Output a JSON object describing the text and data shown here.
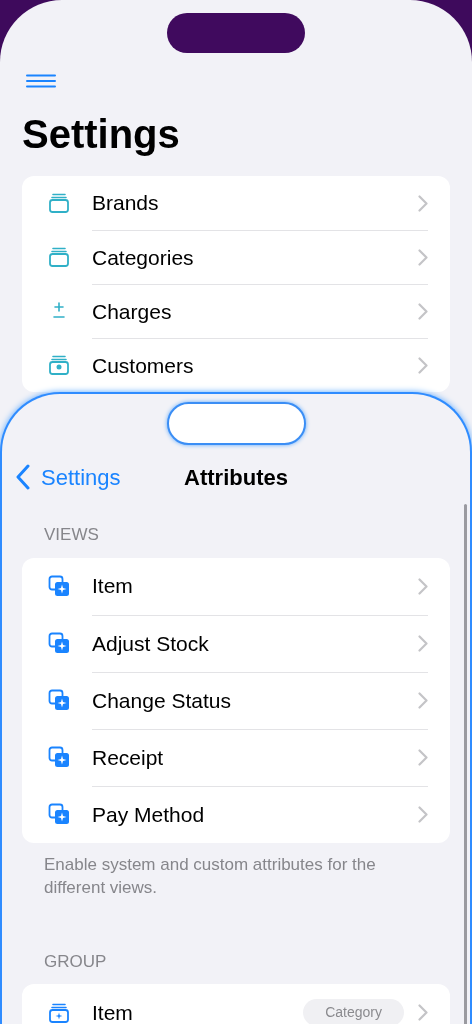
{
  "background_screen": {
    "title": "Settings",
    "items": [
      {
        "label": "Brands",
        "kind": "stack"
      },
      {
        "label": "Categories",
        "kind": "stack"
      },
      {
        "label": "Charges",
        "kind": "plusminus"
      },
      {
        "label": "Customers",
        "kind": "person"
      }
    ]
  },
  "sheet": {
    "back_label": "Settings",
    "title": "Attributes",
    "sections": [
      {
        "header": "VIEWS",
        "rows": [
          {
            "label": "Item",
            "kind": "sparkle"
          },
          {
            "label": "Adjust Stock",
            "kind": "sparkle"
          },
          {
            "label": "Change Status",
            "kind": "sparkle"
          },
          {
            "label": "Receipt",
            "kind": "sparkle"
          },
          {
            "label": "Pay Method",
            "kind": "sparkle"
          }
        ],
        "footer": "Enable system and custom attributes for the different views."
      },
      {
        "header": "GROUP",
        "rows": [
          {
            "label": "Item",
            "kind": "stack-sparkle",
            "badge": "Category"
          }
        ]
      }
    ]
  }
}
